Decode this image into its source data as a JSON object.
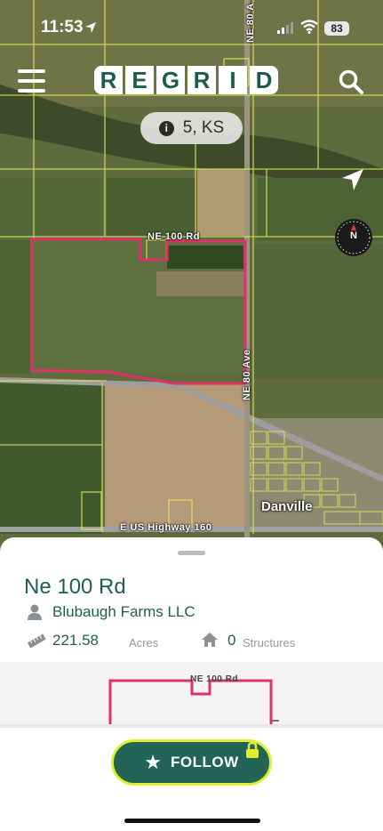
{
  "status_bar": {
    "time": "11:53",
    "battery": "83"
  },
  "header": {
    "logo_letters": [
      "R",
      "E",
      "G",
      "R",
      "I",
      "D"
    ],
    "location_chip": "5, KS"
  },
  "map": {
    "labels": {
      "top_road": "NE 80 A",
      "north_road": "NE 100 Rd",
      "east_road": "NE 80 Ave",
      "highway": "E US Highway 160",
      "town": "Danville"
    },
    "compass_letter": "N"
  },
  "parcel": {
    "title": "Ne 100 Rd",
    "owner": "Blubaugh Farms LLC",
    "acres": "221.58",
    "acres_unit": "Acres",
    "structures": "0",
    "structures_unit": "Structures",
    "preview_label": "NE 100 Rd"
  },
  "actions": {
    "follow_label": "FOLLOW"
  },
  "colors": {
    "brand": "#1f5f53",
    "accent": "#dfee2e",
    "parcel_outline": "#e0306a"
  },
  "icons": [
    "location-arrow-icon",
    "signal-icon",
    "wifi-icon",
    "battery-icon",
    "menu-icon",
    "search-icon",
    "info-icon",
    "navigation-icon",
    "compass-icon",
    "person-icon",
    "ruler-icon",
    "home-icon",
    "star-icon",
    "lock-icon"
  ]
}
